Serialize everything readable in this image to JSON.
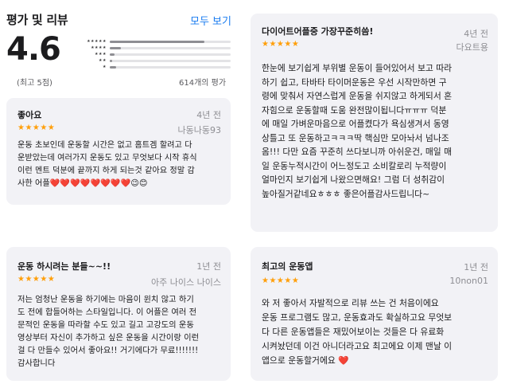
{
  "header": {
    "title": "평가 및 리뷰",
    "see_all_label": "모두 보기"
  },
  "summary": {
    "average_rating": "4.6",
    "max_rating_label": "(최고 5점)",
    "rating_count_label": "614개의 평가",
    "histogram": [
      {
        "stars": "★★★★★",
        "fraction": 0.78
      },
      {
        "stars": "★★★★",
        "fraction": 0.09
      },
      {
        "stars": "★★★",
        "fraction": 0.04
      },
      {
        "stars": "★★",
        "fraction": 0.02
      },
      {
        "stars": "★",
        "fraction": 0.05
      }
    ]
  },
  "colors": {
    "accent": "#1a7cf0",
    "star": "#ff9f0a",
    "card_background": "#f2f2f6"
  },
  "reviews": [
    {
      "title": "좋아요",
      "stars": "★★★★★",
      "rating": 5,
      "date": "4년 전",
      "author": "나동나동93",
      "body": "운동 초보인데 운동할 시간은 없고 홈트겜 할려고 다\n운받았는데 여러가지 운동도 있고 무엇보다 시작 휴식\n이런 멘트 덕분에 끝까지 하게 되는것 같아요 정말 감\n사한 어플❤️❤️❤️❤️❤️❤️❤️❤️😉😊"
    },
    {
      "title": "다이어트어플중 가장꾸준히씀!",
      "stars": "★★★★★",
      "rating": 5,
      "date": "4년 전",
      "author": "다요트용",
      "body": "한눈에 보기쉽게 부위별 운동이 들어있어서 보고 따라\n하기 쉽고, 타바타 타이머운동은 우선 시작만하면 구\n령에 맞춰서 자연스럽게 운동을 쉬지않고 하게되서 혼\n자힘으로 운동할때 도움 완전많이됩니다ㅠㅠㅠ 덕분\n에 매일 가벼운마음으로 어플켰다가 욕심생겨서 동영\n상틀고 또 운동하고ㅋㅋㅋ딱 핵심만 모아놔서 넘나조\n옴!!! 다만 요즘 꾸준히 쓰다보니까 아쉬운건, 매일 매\n일 운동누적시간이 어느정도고 소비칼로리 누적량이\n얼마인지 보기쉽게 나왔으면해요! 그럼 더 성취감이\n높아질거같네요ㅎㅎㅎ 좋은어플감사드립니다~"
    },
    {
      "title": "운동 하시려는 분들~~!!",
      "stars": "★★★★★",
      "rating": 5,
      "date": "1년 전",
      "author": "아주 나이스 나이스",
      "body": "저는 엄청난 운동을 하기에는 마음이 윈치 않고 하기\n도 전에 합들어하는 스타일입니다. 이 어플은 여러 전\n문적인 운동을 따라할 수도 있고 길고 고강도의 운동\n영상부터 자신이 추가하고 싶은 운동을 시간이랑 이런\n걸 다 만들수 있어서 좋아요!! 거기에다가 무료!!!!!!!\n감사합니다"
    },
    {
      "title": "최고의 운동앱",
      "stars": "★★★★★",
      "rating": 5,
      "date": "1년 전",
      "author": "10non01",
      "body": "와 저 좋아서 자발적으로 리뷰 쓰는 건 처음이에요\n운동 프로그램도 많고, 운동효과도 확실하고요 무엇보\n다 다른 운동앱들은 재밌어보이는 것들은 다 유료화\n시켜놨던데 이건 아니더라고요 최고에요 이제 맨날 이\n앱으로 운동할거에요 ❤️"
    }
  ]
}
